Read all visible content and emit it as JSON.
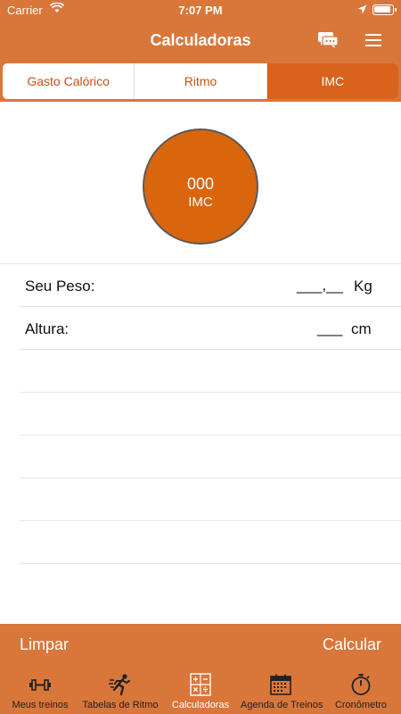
{
  "status_bar": {
    "carrier": "Carrier",
    "time": "7:07 PM"
  },
  "nav": {
    "title": "Calculadoras",
    "chat_icon": "chat-bubbles-icon",
    "menu_icon": "hamburger-menu-icon"
  },
  "segments": [
    {
      "label": "Gasto Calórico",
      "active": false
    },
    {
      "label": "Ritmo",
      "active": false
    },
    {
      "label": "IMC",
      "active": true
    }
  ],
  "result": {
    "value": "000",
    "label": "IMC"
  },
  "form": {
    "weight": {
      "label": "Seu Peso:",
      "placeholder": "___,__",
      "unit": "Kg"
    },
    "height": {
      "label": "Altura:",
      "placeholder": "___",
      "unit": "cm"
    }
  },
  "actions": {
    "clear": "Limpar",
    "calculate": "Calcular"
  },
  "tabs": [
    {
      "label": "Meus treinos",
      "icon": "dumbbell-icon",
      "active": false
    },
    {
      "label": "Tabelas de Ritmo",
      "icon": "runner-icon",
      "active": false
    },
    {
      "label": "Calculadoras",
      "icon": "calculator-icon",
      "active": true
    },
    {
      "label": "Agenda de Treinos",
      "icon": "calendar-icon",
      "active": false
    },
    {
      "label": "Cronômetro",
      "icon": "stopwatch-icon",
      "active": false
    }
  ],
  "colors": {
    "accent": "#d9763a",
    "active_segment": "#d9621c",
    "circle": "#d9650d",
    "segment_text": "#c85016"
  }
}
